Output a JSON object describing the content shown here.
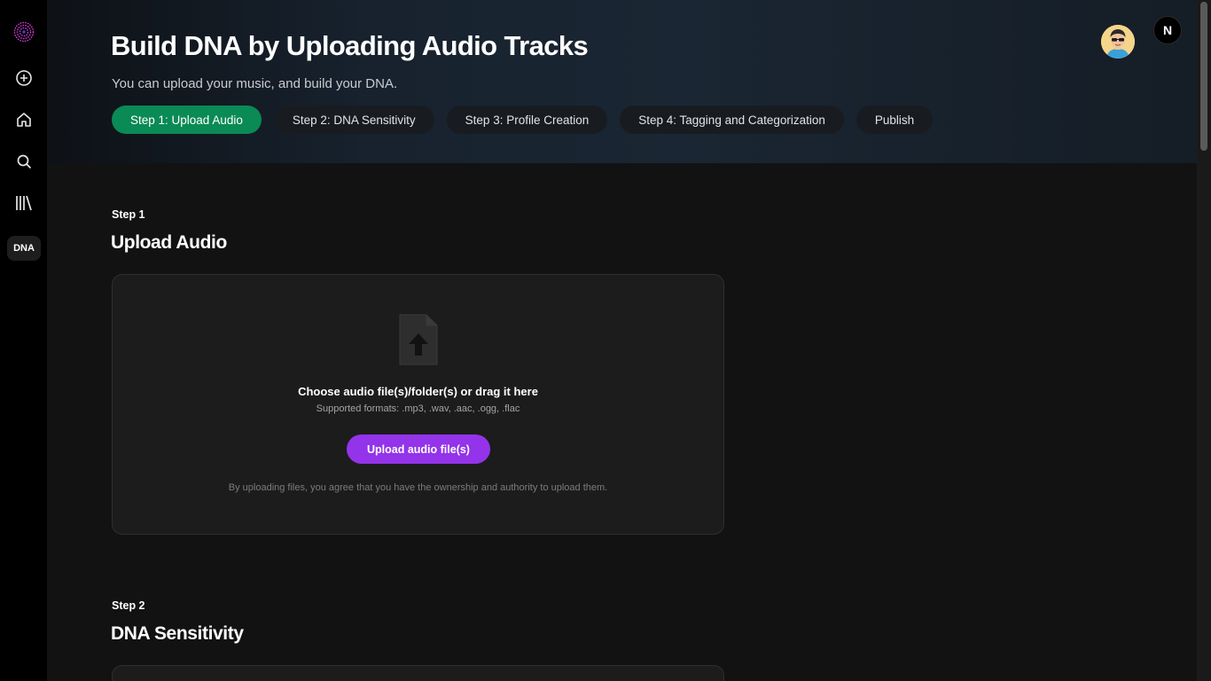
{
  "sidebar": {
    "items": [
      {
        "name": "logo",
        "icon": "logo-icon"
      },
      {
        "name": "create",
        "icon": "plus-circle-icon"
      },
      {
        "name": "home",
        "icon": "home-icon"
      },
      {
        "name": "search",
        "icon": "search-icon"
      },
      {
        "name": "library",
        "icon": "library-icon"
      }
    ],
    "dna_label": "DNA"
  },
  "header": {
    "title": "Build DNA by Uploading Audio Tracks",
    "subtitle": "You can upload your music, and build your DNA.",
    "steps": [
      {
        "label": "Step 1: Upload Audio",
        "active": true
      },
      {
        "label": "Step 2: DNA Sensitivity",
        "active": false
      },
      {
        "label": "Step 3: Profile Creation",
        "active": false
      },
      {
        "label": "Step 4: Tagging and Categorization",
        "active": false
      },
      {
        "label": "Publish",
        "active": false
      }
    ],
    "user_initial": "N"
  },
  "main": {
    "section1": {
      "step_label": "Step 1",
      "title": "Upload Audio",
      "upload": {
        "prompt": "Choose audio file(s)/folder(s) or drag it here",
        "formats": "Supported formats: .mp3, .wav, .aac, .ogg, .flac",
        "button_label": "Upload audio file(s)",
        "disclaimer": "By uploading files, you agree that you have the ownership and authority to upload them."
      }
    },
    "section2": {
      "step_label": "Step 2",
      "title": "DNA Sensitivity"
    }
  },
  "colors": {
    "active_step": "#0a8a55",
    "upload_button": "#9333ea",
    "background": "#121212",
    "sidebar": "#000000"
  }
}
